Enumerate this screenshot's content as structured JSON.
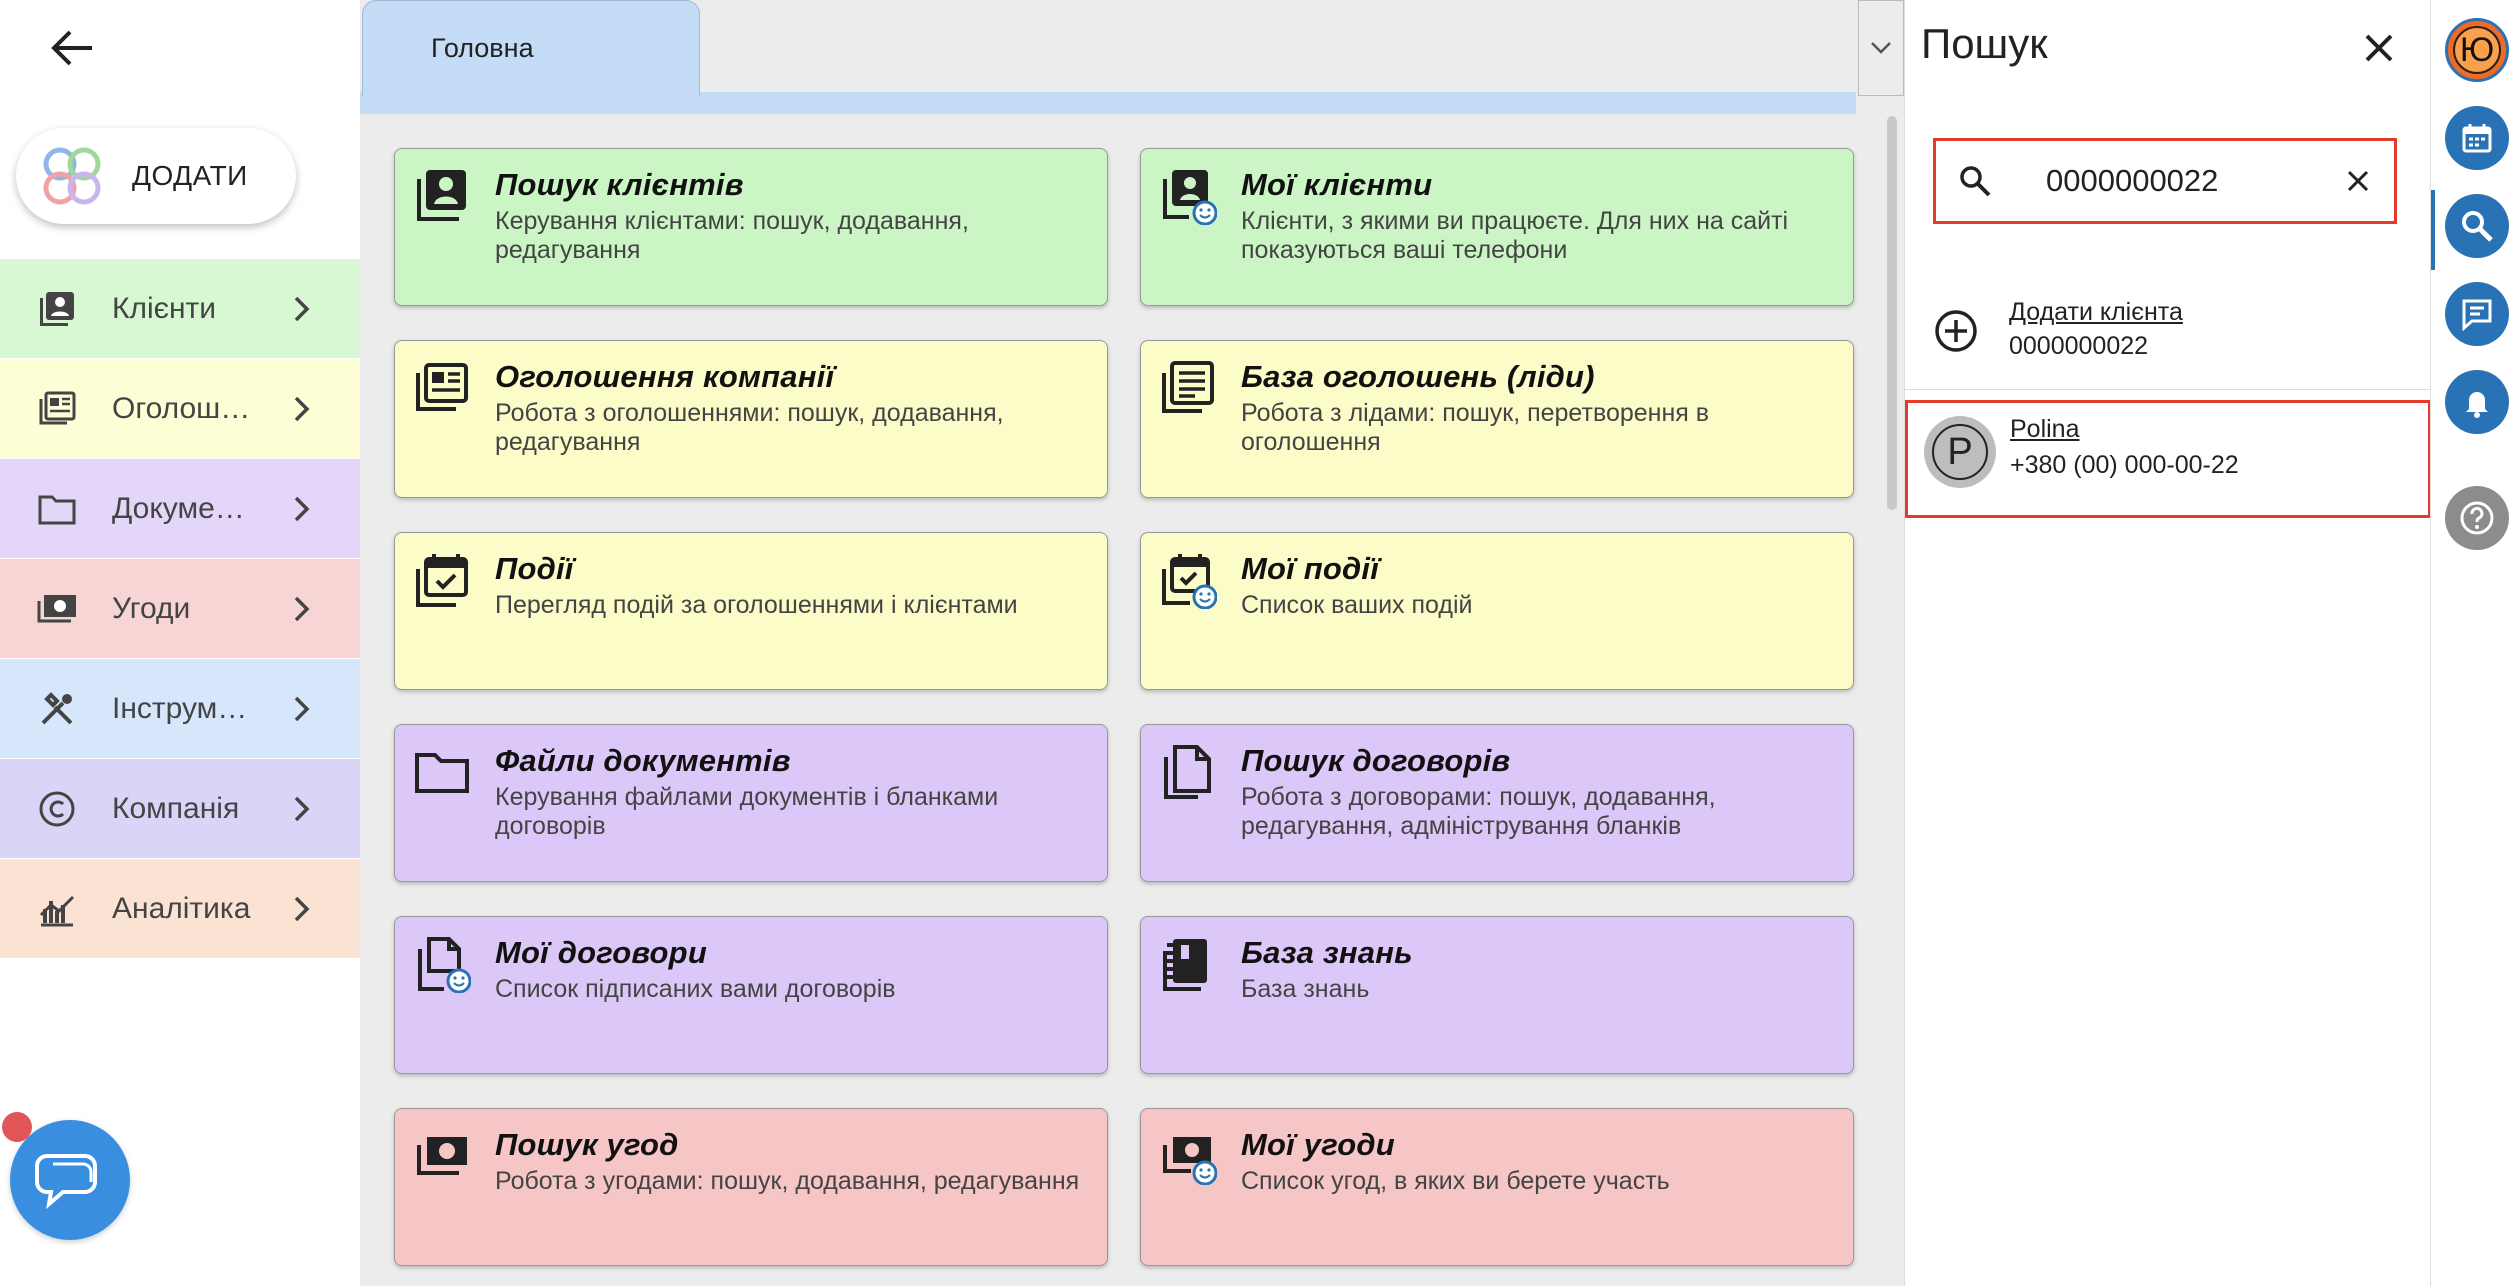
{
  "sidebar": {
    "add_label": "ДОДАТИ",
    "items": [
      {
        "label": "Клієнти",
        "icon": "contacts-icon",
        "bg": "#d8f7d3"
      },
      {
        "label": "Оголоше...",
        "icon": "newspaper-icon",
        "bg": "#fdfdd6"
      },
      {
        "label": "Докумен...",
        "icon": "folder-icon",
        "bg": "#e3d6f9"
      },
      {
        "label": "Угоди",
        "icon": "money-icon",
        "bg": "#f8d5d5"
      },
      {
        "label": "Інструме...",
        "icon": "tools-icon",
        "bg": "#d6e6fb"
      },
      {
        "label": "Компанія",
        "icon": "copyright-icon",
        "bg": "#d9d5f7"
      },
      {
        "label": "Аналітика",
        "icon": "analytics-icon",
        "bg": "#fbe3d4"
      }
    ]
  },
  "tabs": [
    {
      "label": "Головна",
      "active": true
    }
  ],
  "cards": [
    {
      "title": "Пошук клієнтів",
      "desc": "Керування клієнтами: пошук, додавання, редагування",
      "color": "green",
      "icon": "contacts-icon"
    },
    {
      "title": "Мої клієнти",
      "desc": "Клієнти, з якими ви працюєте. Для них на сайті показуються ваші телефони",
      "color": "green",
      "icon": "my-contacts-icon"
    },
    {
      "title": "Оголошення компанії",
      "desc": "Робота з оголошеннями: пошук, додавання, редагування",
      "color": "yellow",
      "icon": "newspaper-icon"
    },
    {
      "title": "База оголошень (ліди)",
      "desc": "Робота з лідами: пошук, перетворення в оголошення",
      "color": "yellow",
      "icon": "article-icon"
    },
    {
      "title": "Події",
      "desc": "Перегляд подій за оголошеннями і клієнтами",
      "color": "yellow",
      "icon": "calendar-check-icon"
    },
    {
      "title": "Мої події",
      "desc": "Список ваших подій",
      "color": "yellow",
      "icon": "my-calendar-icon"
    },
    {
      "title": "Файли документів",
      "desc": "Керування файлами документів і бланками договорів",
      "color": "purple",
      "icon": "folder-icon"
    },
    {
      "title": "Пошук договорів",
      "desc": "Робота з договорами: пошук, додавання, редагування, адміністрування бланків",
      "color": "purple",
      "icon": "documents-icon"
    },
    {
      "title": "Мої договори",
      "desc": "Список підписаних вами договорів",
      "color": "purple",
      "icon": "my-documents-icon"
    },
    {
      "title": "База знань",
      "desc": "База знань",
      "color": "purple",
      "icon": "knowledge-book-icon"
    },
    {
      "title": "Пошук угод",
      "desc": "Робота з угодами: пошук, додавання, редагування",
      "color": "red",
      "icon": "money-icon"
    },
    {
      "title": "Мої угоди",
      "desc": "Список угод, в яких ви берете участь",
      "color": "red",
      "icon": "my-money-icon"
    }
  ],
  "search": {
    "title": "Пошук",
    "query": "0000000022",
    "add_client_label": "Додати клієнта",
    "add_client_number": "0000000022",
    "results": [
      {
        "initial": "P",
        "name": "Polina",
        "phone": "+380 (00) 000-00-22"
      }
    ]
  },
  "rail": {
    "user_initial": "Ю",
    "buttons": [
      "calendar-icon",
      "search-icon",
      "chat-icon",
      "bell-icon",
      "help-icon"
    ]
  },
  "colors": {
    "accent": "#2a72b6",
    "highlight": "#e23b2a",
    "green": "#ccf5c6",
    "yellow": "#fbfcc8",
    "purple": "#dcc8f8",
    "red": "#f6c6c6"
  }
}
